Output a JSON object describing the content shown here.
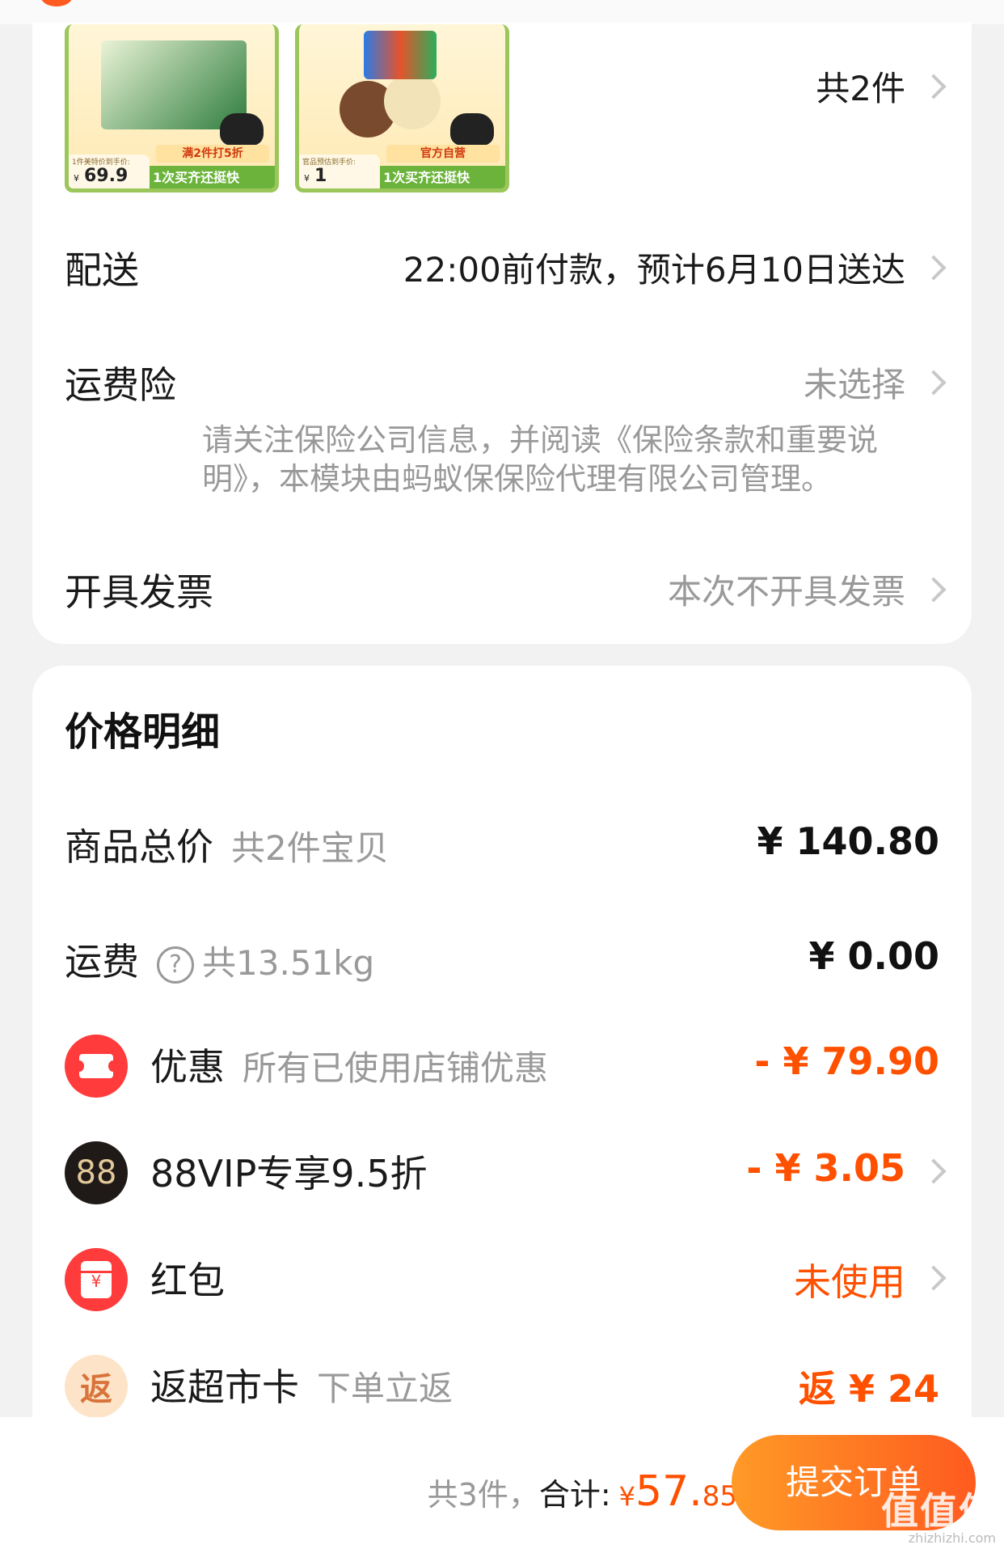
{
  "products": {
    "count_label": "共2件",
    "items": [
      {
        "price_caption": "1件美特价到手价:",
        "price_symbol": "¥",
        "price": "69.9",
        "promo": "满2件打5折",
        "strip": "1次买齐还挺快"
      },
      {
        "price_caption": "官品预估到手价:",
        "price_symbol": "¥",
        "price": "1",
        "promo": "官方自营",
        "strip": "1次买齐还挺快"
      }
    ]
  },
  "delivery": {
    "label": "配送",
    "value": "22:00前付款，预计6月10日送达"
  },
  "insurance": {
    "label": "运费险",
    "value": "未选择",
    "note": "请关注保险公司信息，并阅读《保险条款和重要说明》，本模块由蚂蚁保保险代理有限公司管理。"
  },
  "invoice": {
    "label": "开具发票",
    "value": "本次不开具发票"
  },
  "price_detail": {
    "title": "价格明细",
    "goods_total": {
      "label": "商品总价",
      "sub": "共2件宝贝",
      "amount": "¥ 140.80"
    },
    "shipping": {
      "label": "运费",
      "help": "?",
      "sub": "共13.51kg",
      "amount": "¥ 0.00"
    },
    "discount": {
      "label": "优惠",
      "sub": "所有已使用店铺优惠",
      "amount": "- ¥ 79.90"
    },
    "vip": {
      "icon_text": "88",
      "label": "88VIP专享9.5折",
      "amount": "- ¥ 3.05"
    },
    "red_packet": {
      "icon_text": "¥",
      "label": "红包",
      "amount": "未使用"
    },
    "supermarket_card": {
      "icon_text": "返",
      "label": "返超市卡",
      "sub": "下单立返",
      "amount": "返 ¥ 24"
    }
  },
  "bottom_bar": {
    "count": "共3件，",
    "total_label": "合计:",
    "currency": "¥",
    "total_int": "57.",
    "total_dec": "85",
    "submit_label": "提交订单"
  },
  "watermark": {
    "text": "值值值",
    "url": "zhizhizhi.com"
  },
  "colors": {
    "accent": "#ff5000",
    "background": "#f2f2f2",
    "card": "#ffffff"
  }
}
